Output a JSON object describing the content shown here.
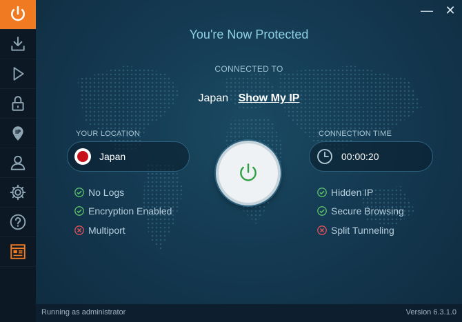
{
  "sidebar": {
    "items": [
      {
        "name": "power",
        "icon": "power-icon",
        "active": true
      },
      {
        "name": "downloads",
        "icon": "download-icon"
      },
      {
        "name": "play",
        "icon": "play-icon"
      },
      {
        "name": "lock",
        "icon": "lock-icon"
      },
      {
        "name": "ip",
        "icon": "ip-location-icon"
      },
      {
        "name": "account",
        "icon": "user-icon"
      },
      {
        "name": "settings",
        "icon": "gear-icon"
      },
      {
        "name": "help",
        "icon": "help-icon"
      },
      {
        "name": "news",
        "icon": "news-icon"
      }
    ]
  },
  "window": {
    "minimize": "—",
    "close": "✕"
  },
  "main": {
    "headline": "You're Now Protected",
    "connected_to_label": "CONNECTED TO",
    "country": "Japan",
    "show_ip_link": "Show My IP"
  },
  "location": {
    "label": "YOUR LOCATION",
    "value": "Japan"
  },
  "time": {
    "label": "CONNECTION TIME",
    "value": "00:00:20"
  },
  "features_left": [
    {
      "label": "No Logs",
      "status": "enabled"
    },
    {
      "label": "Encryption Enabled",
      "status": "enabled"
    },
    {
      "label": "Multiport",
      "status": "disabled"
    }
  ],
  "features_right": [
    {
      "label": "Hidden IP",
      "status": "enabled"
    },
    {
      "label": "Secure Browsing",
      "status": "enabled"
    },
    {
      "label": "Split Tunneling",
      "status": "disabled"
    }
  ],
  "status": {
    "left": "Running as administrator",
    "right": "Version 6.3.1.0"
  },
  "colors": {
    "accent": "#f07a22",
    "enabled": "#5cc26a",
    "disabled": "#e0525a",
    "power": "#2ea043"
  }
}
